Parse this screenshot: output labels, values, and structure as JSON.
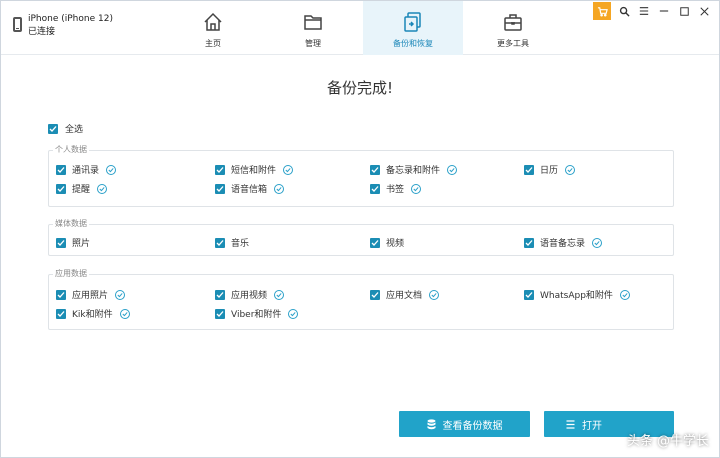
{
  "device": {
    "name": "iPhone (iPhone 12)",
    "status": "已连接"
  },
  "nav": {
    "items": [
      {
        "label": "主页",
        "icon": "home-icon",
        "active": false
      },
      {
        "label": "管理",
        "icon": "folder-icon",
        "active": false
      },
      {
        "label": "备份和恢复",
        "icon": "backup-restore-icon",
        "active": true
      },
      {
        "label": "更多工具",
        "icon": "toolbox-icon",
        "active": false
      }
    ]
  },
  "title": "备份完成!",
  "select_all": "全选",
  "groups": {
    "personal": {
      "title": "个人数据",
      "items": [
        "通讯录",
        "短信和附件",
        "备忘录和附件",
        "日历",
        "提醒",
        "语音信箱",
        "书签"
      ]
    },
    "media": {
      "title": "媒体数据",
      "items": [
        "照片",
        "音乐",
        "视频",
        "语音备忘录"
      ]
    },
    "apps": {
      "title": "应用数据",
      "items": [
        "应用照片",
        "应用视频",
        "应用文档",
        "WhatsApp和附件",
        "Kik和附件",
        "Viber和附件"
      ]
    }
  },
  "buttons": {
    "view_backup": "查看备份数据",
    "open_folder": "打开"
  },
  "watermark": {
    "text": "头条 @牛学长"
  },
  "colors": {
    "accent": "#21a3c9",
    "checkbox": "#1b8db4",
    "cart": "#f5a623",
    "active_nav": "#e8f4fa"
  }
}
